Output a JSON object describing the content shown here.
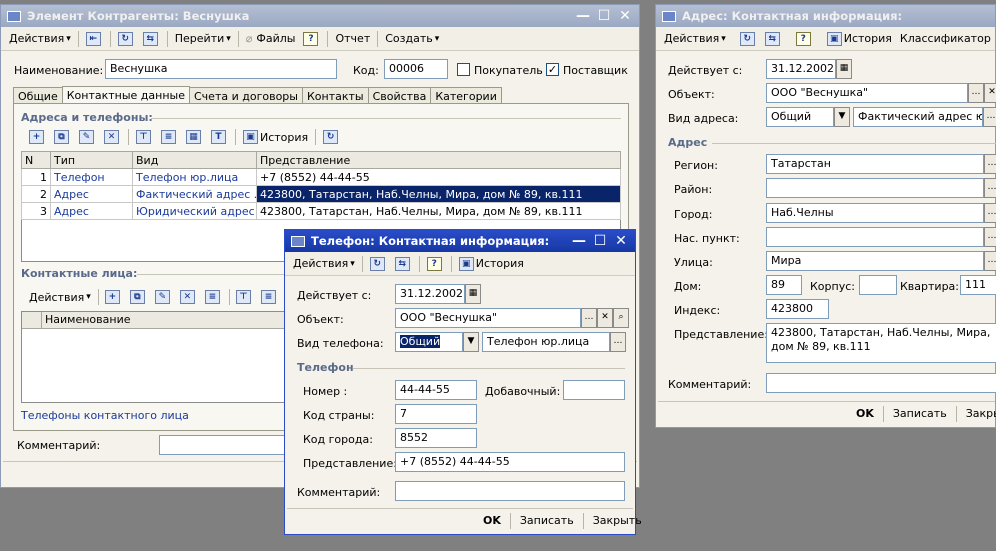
{
  "main": {
    "title": "Элемент Контрагенты: Веснушка",
    "toolbar": {
      "actions": "Действия",
      "goto": "Перейти",
      "files": "Файлы",
      "help": "?",
      "report": "Отчет",
      "create": "Создать"
    },
    "name_label": "Наименование:",
    "name_value": "Веснушка",
    "code_label": "Код:",
    "code_value": "00006",
    "buyer_label": "Покупатель",
    "supplier_label": "Поставщик",
    "tabs": [
      "Общие",
      "Контактные данные",
      "Счета и договоры",
      "Контакты",
      "Свойства",
      "Категории"
    ],
    "addresses_heading": "Адреса и телефоны:",
    "history": "История",
    "grid_headers": [
      "N",
      "Тип",
      "Вид",
      "Представление"
    ],
    "grid_rows": [
      {
        "n": "1",
        "type": "Телефон",
        "kind": "Телефон юр.лица",
        "repr": "+7 (8552) 44-44-55"
      },
      {
        "n": "2",
        "type": "Адрес",
        "kind": "Фактический адрес ...",
        "repr": "423800, Татарстан, Наб.Челны, Мира, дом № 89, кв.111"
      },
      {
        "n": "3",
        "type": "Адрес",
        "kind": "Юридический адрес ...",
        "repr": "423800, Татарстан, Наб.Челны, Мира, дом № 89, кв.111"
      }
    ],
    "contacts_heading": "Контактные лица:",
    "contacts_actions": "Действия",
    "contacts_col": "Наименование",
    "contact_phones_link": "Телефоны контактного лица",
    "comment_label": "Комментарий:"
  },
  "address": {
    "title": "Адрес: Контактная информация:",
    "toolbar": {
      "actions": "Действия",
      "help": "?",
      "history": "История",
      "classifier": "Классификатор"
    },
    "valid_label": "Действует с:",
    "valid_value": "31.12.2002",
    "object_label": "Объект:",
    "object_value": "ООО \"Веснушка\"",
    "kind_label": "Вид адреса:",
    "kind_value": "Общий",
    "kind_value2": "Фактический адрес юр",
    "section": "Адрес",
    "region_label": "Регион:",
    "region_value": "Татарстан",
    "district_label": "Район:",
    "district_value": "",
    "city_label": "Город:",
    "city_value": "Наб.Челны",
    "settlement_label": "Нас. пункт:",
    "settlement_value": "",
    "street_label": "Улица:",
    "street_value": "Мира",
    "house_label": "Дом:",
    "house_value": "89",
    "building_label": "Корпус:",
    "building_value": "",
    "flat_label": "Квартира:",
    "flat_value": "111",
    "index_label": "Индекс:",
    "index_value": "423800",
    "repr_label": "Представление:",
    "repr_value": "423800, Татарстан, Наб.Челны, Мира, дом № 89, кв.111",
    "comment_label": "Комментарий:",
    "ok": "OK",
    "save": "Записать",
    "close": "Закрыть"
  },
  "phone": {
    "title": "Телефон: Контактная информация:",
    "toolbar": {
      "actions": "Действия",
      "help": "?",
      "history": "История"
    },
    "valid_label": "Действует с:",
    "valid_value": "31.12.2002",
    "object_label": "Объект:",
    "object_value": "ООО \"Веснушка\"",
    "kind_label": "Вид телефона:",
    "kind_value": "Общий",
    "kind_value2": "Телефон юр.лица",
    "section": "Телефон",
    "number_label": "Номер :",
    "number_value": "44-44-55",
    "ext_label": "Добавочный:",
    "ext_value": "",
    "country_label": "Код страны:",
    "country_value": "7",
    "city_label": "Код города:",
    "city_value": "8552",
    "repr_label": "Представление:",
    "repr_value": "+7 (8552) 44-44-55",
    "comment_label": "Комментарий:",
    "ok": "OK",
    "save": "Записать",
    "close": "Закрыть"
  }
}
